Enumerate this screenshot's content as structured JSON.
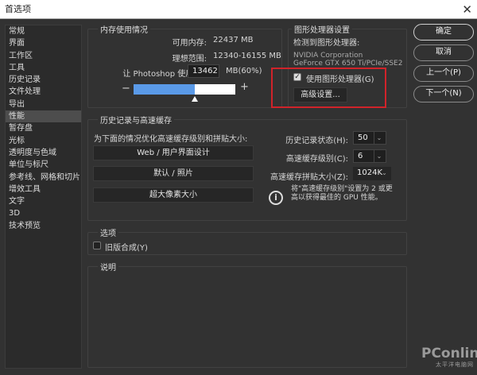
{
  "window": {
    "title": "首选项",
    "close_icon": "close-icon"
  },
  "sidebar": {
    "items": [
      "常规",
      "界面",
      "工作区",
      "工具",
      "历史记录",
      "文件处理",
      "导出",
      "性能",
      "暂存盘",
      "光标",
      "透明度与色域",
      "单位与标尺",
      "参考线、网格和切片",
      "增效工具",
      "文字",
      "3D",
      "技术预览"
    ],
    "active": "性能"
  },
  "memory": {
    "title": "内存使用情况",
    "available_label": "可用内存:",
    "available_value": "22437 MB",
    "ideal_label": "理想范围:",
    "ideal_value": "12340-16155 MB",
    "let_label": "让 Photoshop 使用(L):",
    "let_value": "13462",
    "unit": "MB(60%)",
    "minus": "−",
    "plus": "+",
    "slider_fraction": 0.6
  },
  "gpu": {
    "title": "图形处理器设置",
    "detected_label": "检测到图形处理器:",
    "vendor": "NVIDIA Corporation",
    "model": "GeForce GTX 650 Ti/PCIe/SSE2",
    "use_gpu_label": "使用图形处理器(G)",
    "use_gpu_checked": true,
    "advanced_label": "高级设置...",
    "highlight_color": "#d0232a"
  },
  "buttons": {
    "ok": "确定",
    "cancel": "取消",
    "prev": "上一个(P)",
    "next": "下一个(N)"
  },
  "history": {
    "title": "历史记录与高速缓存",
    "optimize_label": "为下面的情况优化高速缓存级别和拼贴大小:",
    "presets": [
      "Web / 用户界面设计",
      "默认 / 照片",
      "超大像素大小"
    ],
    "states_label": "历史记录状态(H):",
    "states_value": "50",
    "cache_levels_label": "高速缓存级别(C):",
    "cache_levels_value": "6",
    "tile_label": "高速缓存拼贴大小(Z):",
    "tile_value": "1024K",
    "info": "将\"高速缓存级别\"设置为 2 或更高以获得最佳的 GPU 性能。"
  },
  "options": {
    "title": "选项",
    "legacy_label": "旧版合成(Y)",
    "legacy_checked": false
  },
  "description": {
    "title": "说明"
  },
  "watermark": {
    "brand": "PConline",
    "sub": "太平洋电脑网"
  }
}
